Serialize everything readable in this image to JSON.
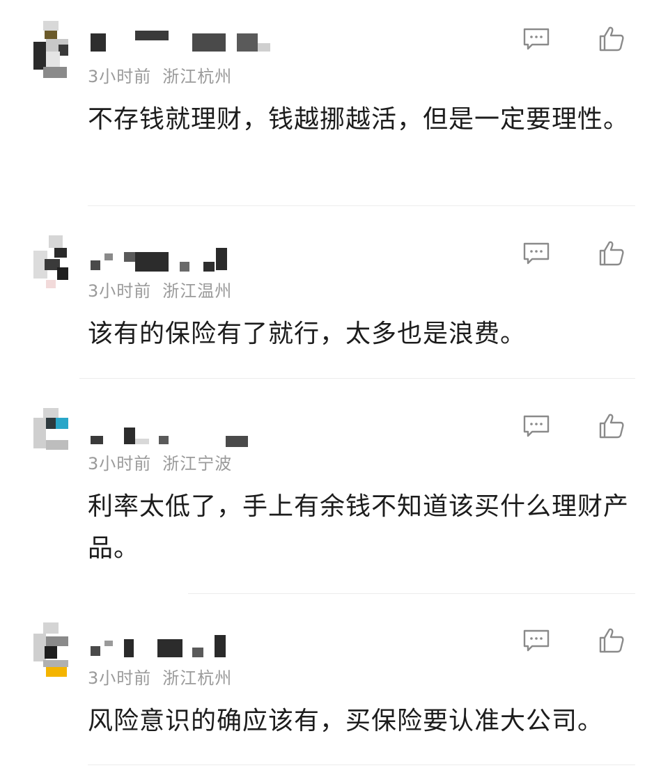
{
  "comments": [
    {
      "time": "3小时前",
      "location": "浙江杭州",
      "text": "不存钱就理财，钱越挪越活，但是一定要理性。"
    },
    {
      "time": "3小时前",
      "location": "浙江温州",
      "text": "该有的保险有了就行，太多也是浪费。"
    },
    {
      "time": "3小时前",
      "location": "浙江宁波",
      "text": "利率太低了，手上有余钱不知道该买什么理财产品。"
    },
    {
      "time": "3小时前",
      "location": "浙江杭州",
      "text": "风险意识的确应该有，买保险要认准大公司。"
    }
  ],
  "icons": {
    "reply": "comment-bubble-icon",
    "like": "thumbs-up-icon"
  },
  "colors": {
    "meta_text": "#9a9a9a",
    "body_text": "#1c1c1c",
    "icon_stroke": "#8a8a8a",
    "divider": "#ececec",
    "background": "#ffffff"
  }
}
